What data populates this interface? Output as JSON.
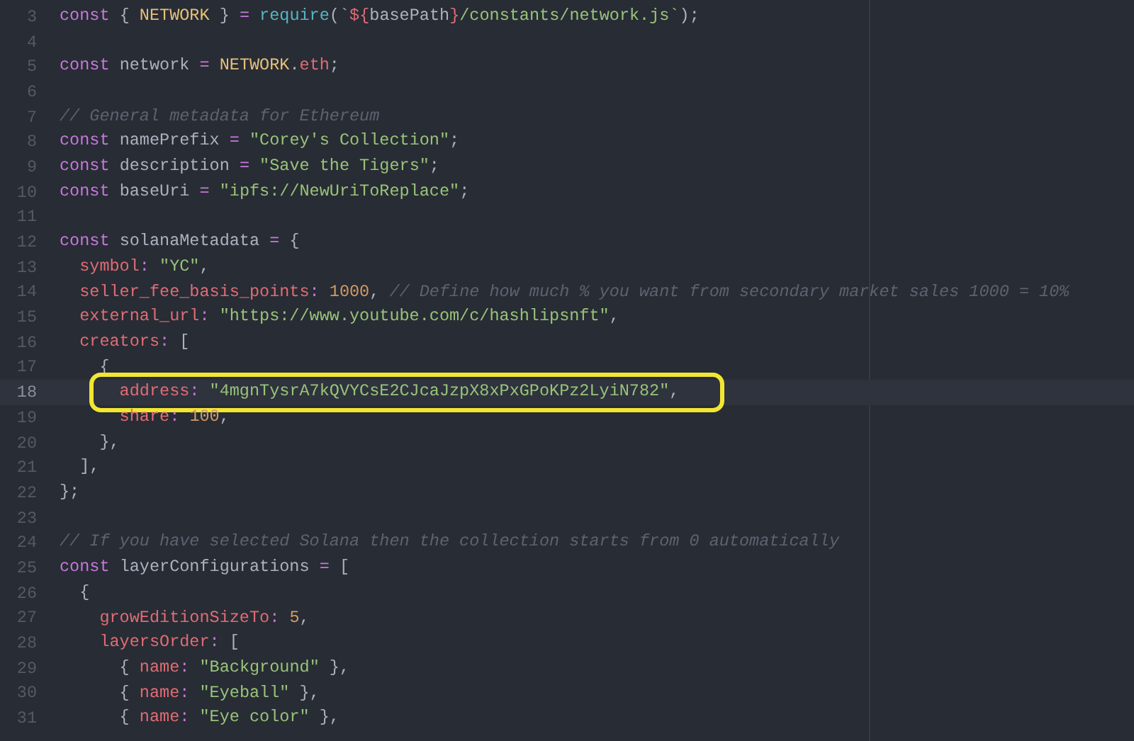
{
  "editor": {
    "lines": [
      {
        "number": "3",
        "tokens": [
          {
            "kind": "kw",
            "text": "const"
          },
          {
            "kind": "p",
            "text": " { "
          },
          {
            "kind": "c",
            "text": "NETWORK"
          },
          {
            "kind": "p",
            "text": " } "
          },
          {
            "kind": "op",
            "text": "= "
          },
          {
            "kind": "fn",
            "text": "require"
          },
          {
            "kind": "p",
            "text": "("
          },
          {
            "kind": "s",
            "text": "`"
          },
          {
            "kind": "prop",
            "text": "${"
          },
          {
            "kind": "p",
            "text": "basePath"
          },
          {
            "kind": "prop",
            "text": "}"
          },
          {
            "kind": "s",
            "text": "/constants/network.js`"
          },
          {
            "kind": "p",
            "text": ");"
          }
        ]
      },
      {
        "number": "4"
      },
      {
        "number": "5",
        "tokens": [
          {
            "kind": "kw",
            "text": "const"
          },
          {
            "kind": "p",
            "text": " network "
          },
          {
            "kind": "op",
            "text": "= "
          },
          {
            "kind": "c",
            "text": "NETWORK"
          },
          {
            "kind": "p",
            "text": "."
          },
          {
            "kind": "prop",
            "text": "eth"
          },
          {
            "kind": "p",
            "text": ";"
          }
        ]
      },
      {
        "number": "6"
      },
      {
        "number": "7",
        "tokens": [
          {
            "kind": "cm",
            "text": "// General metadata for Ethereum"
          }
        ]
      },
      {
        "number": "8",
        "tokens": [
          {
            "kind": "kw",
            "text": "const"
          },
          {
            "kind": "p",
            "text": " namePrefix "
          },
          {
            "kind": "op",
            "text": "= "
          },
          {
            "kind": "s",
            "text": "\"Corey's Collection\""
          },
          {
            "kind": "p",
            "text": ";"
          }
        ]
      },
      {
        "number": "9",
        "tokens": [
          {
            "kind": "kw",
            "text": "const"
          },
          {
            "kind": "p",
            "text": " description "
          },
          {
            "kind": "op",
            "text": "= "
          },
          {
            "kind": "s",
            "text": "\"Save the Tigers\""
          },
          {
            "kind": "p",
            "text": ";"
          }
        ]
      },
      {
        "number": "10",
        "tokens": [
          {
            "kind": "kw",
            "text": "const"
          },
          {
            "kind": "p",
            "text": " baseUri "
          },
          {
            "kind": "op",
            "text": "= "
          },
          {
            "kind": "s",
            "text": "\"ipfs://NewUriToReplace\""
          },
          {
            "kind": "p",
            "text": ";"
          }
        ]
      },
      {
        "number": "11"
      },
      {
        "number": "12",
        "tokens": [
          {
            "kind": "kw",
            "text": "const"
          },
          {
            "kind": "p",
            "text": " solanaMetadata "
          },
          {
            "kind": "op",
            "text": "= "
          },
          {
            "kind": "p",
            "text": "{"
          }
        ]
      },
      {
        "number": "13",
        "tokens": [
          {
            "kind": "prop",
            "text": "  symbol"
          },
          {
            "kind": "op",
            "text": ": "
          },
          {
            "kind": "s",
            "text": "\"YC\""
          },
          {
            "kind": "p",
            "text": ","
          }
        ]
      },
      {
        "number": "14",
        "tokens": [
          {
            "kind": "prop",
            "text": "  seller_fee_basis_points"
          },
          {
            "kind": "op",
            "text": ": "
          },
          {
            "kind": "n",
            "text": "1000"
          },
          {
            "kind": "p",
            "text": ", "
          },
          {
            "kind": "cm",
            "text": "// Define how much % you want from secondary market sales 1000 = 10%"
          }
        ]
      },
      {
        "number": "15",
        "tokens": [
          {
            "kind": "prop",
            "text": "  external_url"
          },
          {
            "kind": "op",
            "text": ": "
          },
          {
            "kind": "s",
            "text": "\"https://www.youtube.com/c/hashlipsnft\""
          },
          {
            "kind": "p",
            "text": ","
          }
        ]
      },
      {
        "number": "16",
        "tokens": [
          {
            "kind": "prop",
            "text": "  creators"
          },
          {
            "kind": "op",
            "text": ": "
          },
          {
            "kind": "p",
            "text": "["
          }
        ]
      },
      {
        "number": "17",
        "tokens": [
          {
            "kind": "p",
            "text": "    {"
          }
        ]
      },
      {
        "number": "18",
        "current": true,
        "boxed": true,
        "tokens": [
          {
            "kind": "prop",
            "text": "      address"
          },
          {
            "kind": "op",
            "text": ": "
          },
          {
            "kind": "s",
            "text": "\"4mgnTysrA7kQVYCsE2CJcaJzpX8xPxGPoKPz2LyiN782\""
          },
          {
            "kind": "p",
            "text": ","
          }
        ]
      },
      {
        "number": "19",
        "tokens": [
          {
            "kind": "prop",
            "text": "      share"
          },
          {
            "kind": "op",
            "text": ": "
          },
          {
            "kind": "n",
            "text": "100"
          },
          {
            "kind": "p",
            "text": ","
          }
        ]
      },
      {
        "number": "20",
        "tokens": [
          {
            "kind": "p",
            "text": "    },"
          }
        ]
      },
      {
        "number": "21",
        "tokens": [
          {
            "kind": "p",
            "text": "  ],"
          }
        ]
      },
      {
        "number": "22",
        "tokens": [
          {
            "kind": "p",
            "text": "};"
          }
        ]
      },
      {
        "number": "23"
      },
      {
        "number": "24",
        "tokens": [
          {
            "kind": "cm",
            "text": "// If you have selected Solana then the collection starts from 0 automatically"
          }
        ]
      },
      {
        "number": "25",
        "tokens": [
          {
            "kind": "kw",
            "text": "const"
          },
          {
            "kind": "p",
            "text": " layerConfigurations "
          },
          {
            "kind": "op",
            "text": "= "
          },
          {
            "kind": "p",
            "text": "["
          }
        ]
      },
      {
        "number": "26",
        "tokens": [
          {
            "kind": "p",
            "text": "  {"
          }
        ]
      },
      {
        "number": "27",
        "tokens": [
          {
            "kind": "prop",
            "text": "    growEditionSizeTo"
          },
          {
            "kind": "op",
            "text": ": "
          },
          {
            "kind": "n",
            "text": "5"
          },
          {
            "kind": "p",
            "text": ","
          }
        ]
      },
      {
        "number": "28",
        "tokens": [
          {
            "kind": "prop",
            "text": "    layersOrder"
          },
          {
            "kind": "op",
            "text": ": "
          },
          {
            "kind": "p",
            "text": "["
          }
        ]
      },
      {
        "number": "29",
        "tokens": [
          {
            "kind": "p",
            "text": "      { "
          },
          {
            "kind": "prop",
            "text": "name"
          },
          {
            "kind": "op",
            "text": ": "
          },
          {
            "kind": "s",
            "text": "\"Background\""
          },
          {
            "kind": "p",
            "text": " },"
          }
        ]
      },
      {
        "number": "30",
        "tokens": [
          {
            "kind": "p",
            "text": "      { "
          },
          {
            "kind": "prop",
            "text": "name"
          },
          {
            "kind": "op",
            "text": ": "
          },
          {
            "kind": "s",
            "text": "\"Eyeball\""
          },
          {
            "kind": "p",
            "text": " },"
          }
        ]
      },
      {
        "number": "31",
        "tokens": [
          {
            "kind": "p",
            "text": "      { "
          },
          {
            "kind": "prop",
            "text": "name"
          },
          {
            "kind": "op",
            "text": ": "
          },
          {
            "kind": "s",
            "text": "\"Eye color\""
          },
          {
            "kind": "p",
            "text": " },"
          }
        ]
      }
    ]
  }
}
